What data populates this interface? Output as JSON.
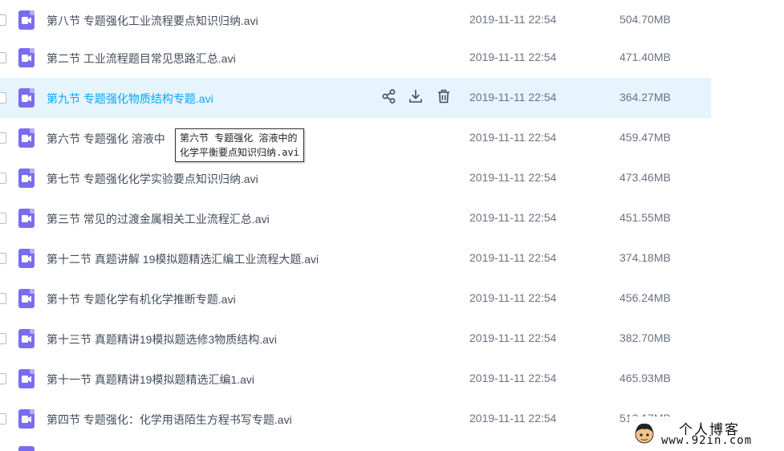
{
  "files": [
    {
      "name": "第八节 专题强化工业流程要点知识归纳.avi",
      "date": "2019-11-11 22:54",
      "size": "504.70MB"
    },
    {
      "name": "第二节 工业流程题目常见思路汇总.avi",
      "date": "2019-11-11 22:54",
      "size": "471.40MB"
    },
    {
      "name": "第九节 专题强化物质结构专题.avi",
      "date": "2019-11-11 22:54",
      "size": "364.27MB"
    },
    {
      "name": "第六节 专题强化 溶液中",
      "date": "2019-11-11 22:54",
      "size": "459.47MB"
    },
    {
      "name": "第七节 专题强化化学实验要点知识归纳.avi",
      "date": "2019-11-11 22:54",
      "size": "473.46MB"
    },
    {
      "name": "第三节 常见的过渡金属相关工业流程汇总.avi",
      "date": "2019-11-11 22:54",
      "size": "451.55MB"
    },
    {
      "name": "第十二节 真题讲解 19模拟题精选汇编工业流程大题.avi",
      "date": "2019-11-11 22:54",
      "size": "374.18MB"
    },
    {
      "name": "第十节 专题化学有机化学推断专题.avi",
      "date": "2019-11-11 22:54",
      "size": "456.24MB"
    },
    {
      "name": "第十三节 真题精讲19模拟题选修3物质结构.avi",
      "date": "2019-11-11 22:54",
      "size": "382.70MB"
    },
    {
      "name": "第十一节 真题精讲19模拟题精选汇编1.avi",
      "date": "2019-11-11 22:54",
      "size": "465.93MB"
    },
    {
      "name": "第四节 专题强化：化学用语陌生方程书写专题.avi",
      "date": "2019-11-11 22:54",
      "size": "513.17MB"
    }
  ],
  "tooltip": {
    "line1": "第六节 专题强化 溶液中的",
    "line2": "化学平衡要点知识归纳.avi"
  },
  "watermark": {
    "title": "个人博客",
    "url": "www.92in.com"
  },
  "colors": {
    "hover_bg": "#e5f4fd",
    "hover_text": "#06a7ff",
    "file_icon": "#7a6cf0"
  },
  "hover_index": 2
}
